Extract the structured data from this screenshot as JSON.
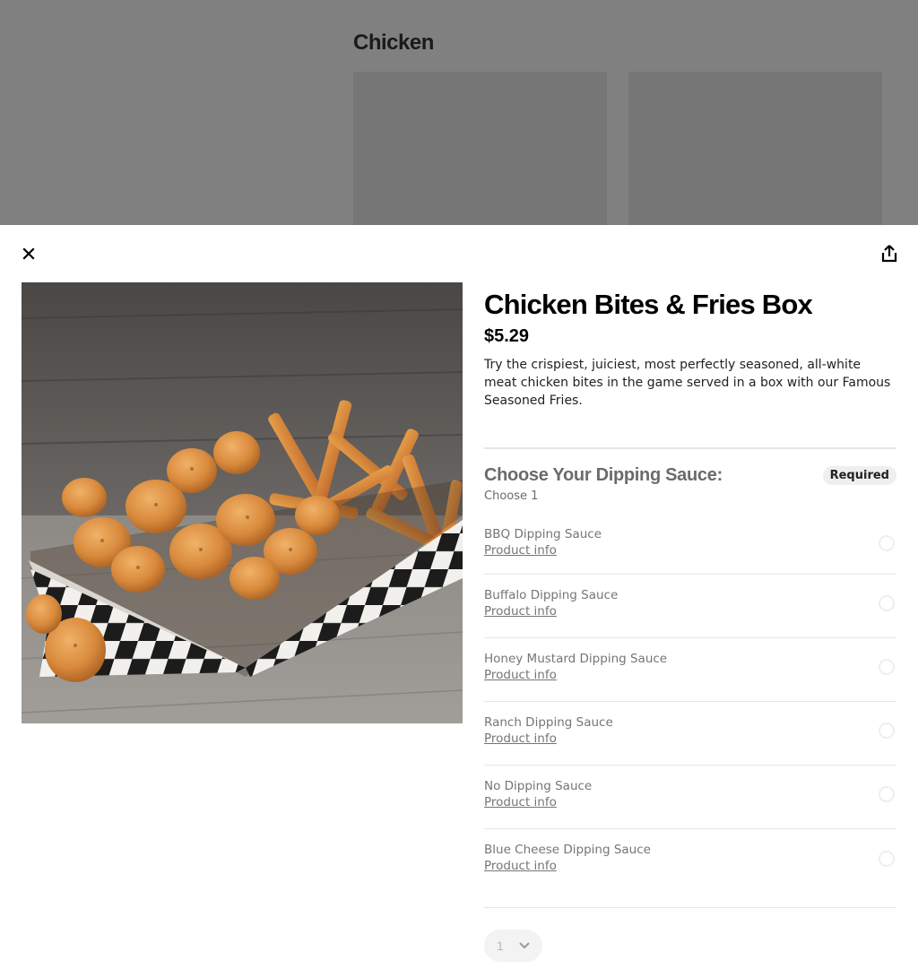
{
  "background": {
    "section_title": "Chicken"
  },
  "modal": {
    "close_icon": "close-icon",
    "share_icon": "share-icon",
    "product": {
      "title": "Chicken Bites & Fries Box",
      "price": "$5.29",
      "description": "Try the crispiest, juiciest, most perfectly seasoned, all-white meat chicken bites in the game served in a box with our Famous Seasoned Fries."
    },
    "sauce_section": {
      "title": "Choose Your Dipping Sauce:",
      "badge": "Required",
      "subtitle": "Choose 1",
      "options": [
        {
          "name": "BBQ Dipping Sauce",
          "link": "Product info"
        },
        {
          "name": "Buffalo Dipping Sauce",
          "link": "Product info"
        },
        {
          "name": "Honey Mustard Dipping Sauce",
          "link": "Product info"
        },
        {
          "name": "Ranch Dipping Sauce",
          "link": "Product info"
        },
        {
          "name": "No Dipping Sauce",
          "link": "Product info"
        },
        {
          "name": "Blue Cheese Dipping Sauce",
          "link": "Product info"
        }
      ]
    },
    "quantity": {
      "value": "1"
    }
  },
  "colors": {
    "overlay": "#808080",
    "text_primary": "#000000",
    "text_muted": "#757575",
    "divider": "#e6e6e6"
  }
}
